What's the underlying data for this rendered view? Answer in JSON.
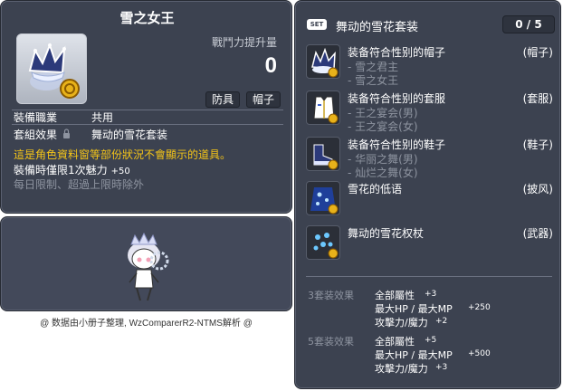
{
  "item_id": "01004898",
  "item": {
    "name": "雪之女王",
    "combat_power_label": "戰鬥力提升量",
    "combat_power_value": "0",
    "tags": [
      "防具",
      "帽子"
    ],
    "job_label": "裝備職業",
    "job_value": "共用",
    "set_label": "套組效果",
    "set_value": "舞动的雪花套装",
    "warning": "這是角色資料窗等部份狀況不會顯示的道具。",
    "charm_label": "裝備時僅限1次魅力",
    "charm_value": "+50",
    "limit_note": "每日限制、超過上限時除外"
  },
  "credits": "@ 数据由小册子整理, WzComparerR2-NTMS解析 @",
  "set": {
    "badge": "SET",
    "name": "舞动的雪花套装",
    "count": "0 / 5",
    "parts": [
      {
        "title": "装备符合性别的帽子",
        "type": "(帽子)",
        "options": [
          "- 雪之君主",
          "- 雪之女王"
        ]
      },
      {
        "title": "装备符合性别的套服",
        "type": "(套服)",
        "options": [
          "- 王之宴会(男)",
          "- 王之宴会(女)"
        ]
      },
      {
        "title": "装备符合性别的鞋子",
        "type": "(鞋子)",
        "options": [
          "- 华丽之舞(男)",
          "- 灿烂之舞(女)"
        ]
      },
      {
        "title": "雪花的低语",
        "type": "(披风)",
        "options": []
      },
      {
        "title": "舞动的雪花权杖",
        "type": "(武器)",
        "options": []
      }
    ],
    "bonuses": [
      {
        "label": "3套装效果",
        "lines": [
          {
            "stat": "全部屬性",
            "value": "+3"
          },
          {
            "stat": "最大HP / 最大MP",
            "value": "+250"
          },
          {
            "stat": "攻擊力/魔力",
            "value": "+2"
          }
        ]
      },
      {
        "label": "5套装效果",
        "lines": [
          {
            "stat": "全部屬性",
            "value": "+5"
          },
          {
            "stat": "最大HP / 最大MP",
            "value": "+500"
          },
          {
            "stat": "攻擊力/魔力",
            "value": "+3"
          }
        ]
      }
    ]
  },
  "colors": {
    "panel_bg": "#3c4250",
    "warning": "#f5c518",
    "muted": "#8e94a0",
    "coin": "#e8b21a"
  }
}
